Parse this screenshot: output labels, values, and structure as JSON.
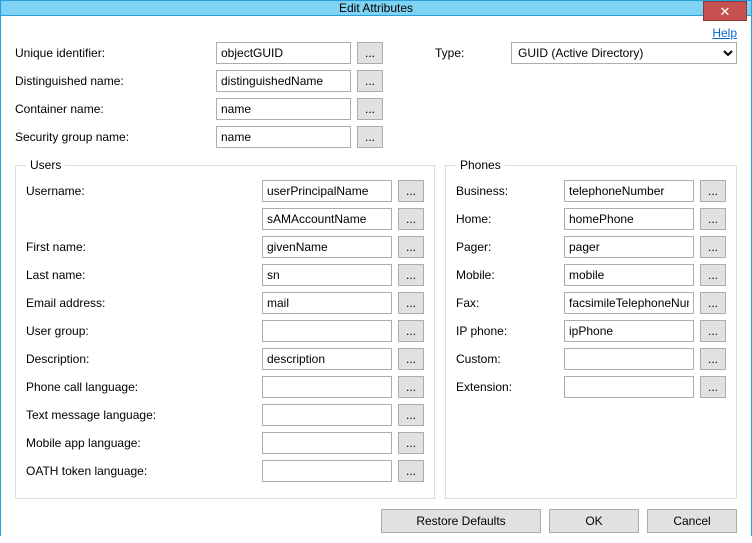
{
  "window": {
    "title": "Edit Attributes",
    "close_glyph": "✕"
  },
  "help": {
    "label": "Help"
  },
  "top": {
    "unique_identifier_label": "Unique identifier:",
    "unique_identifier_value": "objectGUID",
    "distinguished_name_label": "Distinguished name:",
    "distinguished_name_value": "distinguishedName",
    "container_name_label": "Container name:",
    "container_name_value": "name",
    "security_group_label": "Security group name:",
    "security_group_value": "name",
    "type_label": "Type:",
    "type_value": "GUID (Active Directory)",
    "browse_glyph": "..."
  },
  "users": {
    "legend": "Users",
    "rows": [
      {
        "label": "Username:",
        "value": "userPrincipalName"
      },
      {
        "label": "",
        "value": "sAMAccountName"
      },
      {
        "label": "First name:",
        "value": "givenName"
      },
      {
        "label": "Last name:",
        "value": "sn"
      },
      {
        "label": "Email address:",
        "value": "mail"
      },
      {
        "label": "User group:",
        "value": ""
      },
      {
        "label": "Description:",
        "value": "description"
      },
      {
        "label": "Phone call language:",
        "value": ""
      },
      {
        "label": "Text message language:",
        "value": ""
      },
      {
        "label": "Mobile app language:",
        "value": ""
      },
      {
        "label": "OATH token language:",
        "value": ""
      }
    ]
  },
  "phones": {
    "legend": "Phones",
    "rows": [
      {
        "label": "Business:",
        "value": "telephoneNumber"
      },
      {
        "label": "Home:",
        "value": "homePhone"
      },
      {
        "label": "Pager:",
        "value": "pager"
      },
      {
        "label": "Mobile:",
        "value": "mobile"
      },
      {
        "label": "Fax:",
        "value": "facsimileTelephoneNumber"
      },
      {
        "label": "IP phone:",
        "value": "ipPhone"
      },
      {
        "label": "Custom:",
        "value": ""
      },
      {
        "label": "Extension:",
        "value": ""
      }
    ]
  },
  "buttons": {
    "restore": "Restore Defaults",
    "ok": "OK",
    "cancel": "Cancel"
  }
}
